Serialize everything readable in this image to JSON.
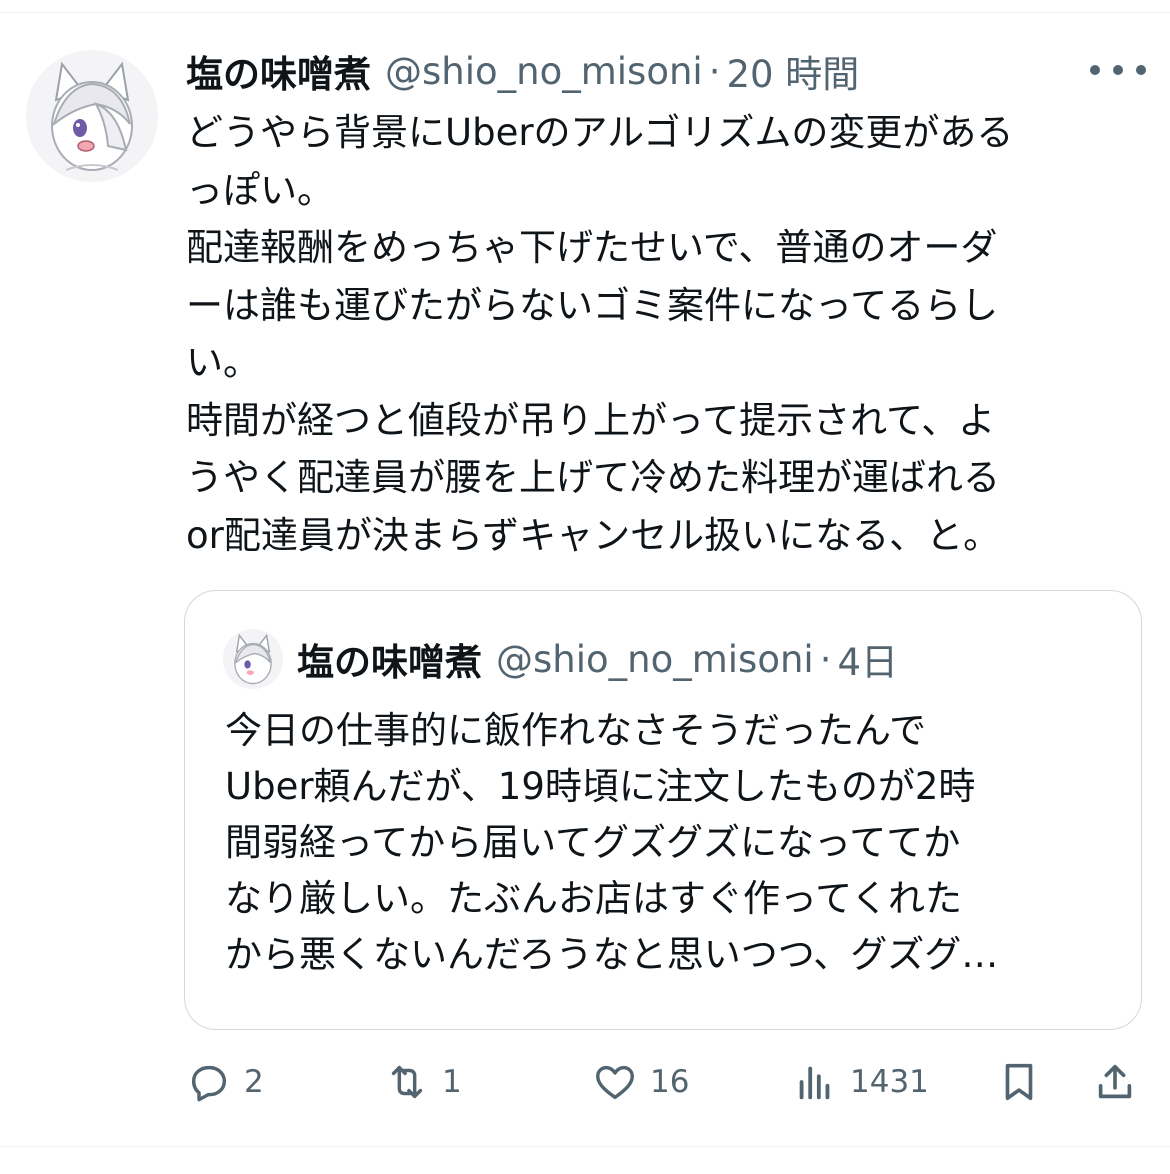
{
  "tweet": {
    "display_name": "塩の味噌煮",
    "handle": "@shio_no_misoni",
    "separator": "·",
    "time": "20 時間",
    "lines": [
      "どうやら背景にUberのアルゴリズムの変更がある",
      "っぽい。",
      "配達報酬をめっちゃ下げたせいで、普通のオーダ",
      "ーは誰も運びたがらないゴミ案件になってるらし",
      "い。",
      "時間が経つと値段が吊り上がって提示されて、よ",
      "うやく配達員が腰を上げて冷めた料理が運ばれる",
      "or配達員が決まらずキャンセル扱いになる、と。"
    ]
  },
  "quote": {
    "display_name": "塩の味噌煮",
    "handle": "@shio_no_misoni",
    "separator": "·",
    "time": "4日",
    "lines": [
      "今日の仕事的に飯作れなさそうだったんで",
      "Uber頼んだが、19時頃に注文したものが2時",
      "間弱経ってから届いてグズグズになっててか",
      "なり厳しい。たぶんお店はすぐ作ってくれた",
      "から悪くないんだろうなと思いつつ、グズグ…"
    ]
  },
  "actions": {
    "reply_count": "2",
    "retweet_count": "1",
    "like_count": "16",
    "views_count": "1431"
  },
  "icons": {
    "more": "more-dots-icon",
    "reply": "reply-bubble-icon",
    "retweet": "retweet-arrows-icon",
    "like": "heart-icon",
    "views": "views-bars-icon",
    "bookmark": "bookmark-icon",
    "share": "share-upload-icon"
  },
  "colors": {
    "text": "#0f1419",
    "secondary": "#536471",
    "border": "#cfd9de"
  }
}
